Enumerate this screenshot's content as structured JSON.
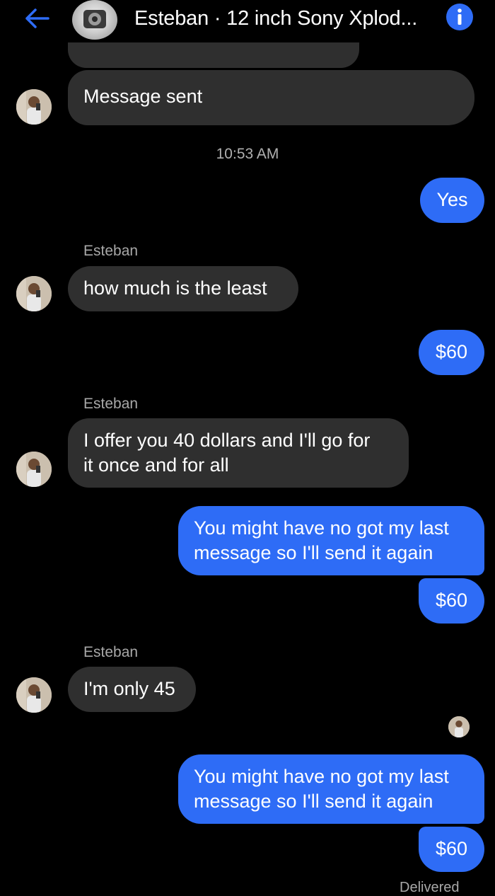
{
  "header": {
    "title": "Esteban · 12 inch Sony Xplod...",
    "back_icon": "back-arrow-icon",
    "info_icon": "info-icon",
    "accent": "#2e6cf6"
  },
  "messages": {
    "m1": "Message sent",
    "time1": "10:53 AM",
    "m2": "Yes",
    "sender2": "Esteban",
    "m3": "how much is the least",
    "m4": "$60",
    "sender3": "Esteban",
    "m5_line1": "I offer you 40 dollars and I'll go for",
    "m5_line2": "it once and for all",
    "m6_line1": "You might have no got my last",
    "m6_line2": "message so I'll send it again",
    "m7": "$60",
    "sender4": "Esteban",
    "m8": "I'm only 45",
    "m9_line1": "You might have no got my last",
    "m9_line2": "message so I'll send it again",
    "m10": "$60",
    "status": "Delivered"
  },
  "colors": {
    "incoming_bubble": "#2f2f2f",
    "outgoing_bubble": "#2e6cf6",
    "background": "#000000"
  }
}
